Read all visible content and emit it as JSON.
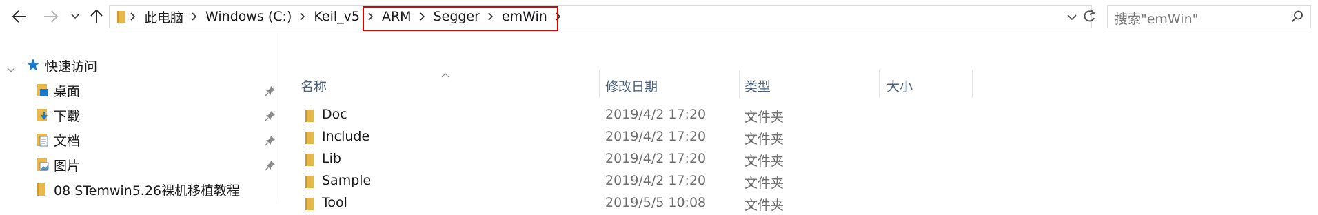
{
  "address": {
    "crumbs": [
      "此电脑",
      "Windows (C:)",
      "Keil_v5",
      "ARM",
      "Segger",
      "emWin"
    ]
  },
  "search": {
    "placeholder": "搜索\"emWin\""
  },
  "nav": {
    "quick_access": "快速访问",
    "items": [
      {
        "label": "桌面",
        "pinned": true
      },
      {
        "label": "下载",
        "pinned": true
      },
      {
        "label": "文档",
        "pinned": true
      },
      {
        "label": "图片",
        "pinned": true
      },
      {
        "label": "08 STemwin5.26裸机移植教程",
        "pinned": false
      }
    ]
  },
  "columns": {
    "name": "名称",
    "date": "修改日期",
    "type": "类型",
    "size": "大小"
  },
  "files": [
    {
      "name": "Doc",
      "date": "2019/4/2 17:20",
      "type": "文件夹"
    },
    {
      "name": "Include",
      "date": "2019/4/2 17:20",
      "type": "文件夹"
    },
    {
      "name": "Lib",
      "date": "2019/4/2 17:20",
      "type": "文件夹"
    },
    {
      "name": "Sample",
      "date": "2019/4/2 17:20",
      "type": "文件夹"
    },
    {
      "name": "Tool",
      "date": "2019/5/5 10:08",
      "type": "文件夹"
    }
  ],
  "colors": {
    "highlight": "#e00000",
    "folder": "#e8b84a",
    "header_text": "#4c607a",
    "accent": "#1979ca"
  }
}
